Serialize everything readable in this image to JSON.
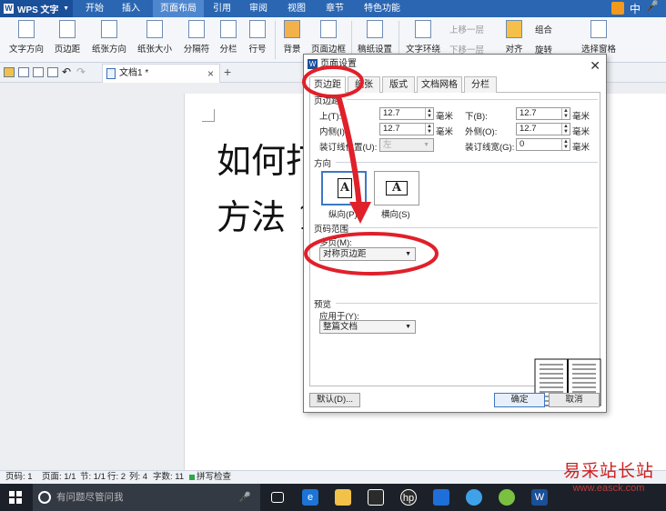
{
  "app": {
    "name": "WPS 文字"
  },
  "menu": {
    "items": [
      "开始",
      "插入",
      "页面布局",
      "引用",
      "审阅",
      "视图",
      "章节",
      "特色功能"
    ],
    "active": "页面布局"
  },
  "tray": {
    "ime": "中",
    "mic": "🎤"
  },
  "ribbon": {
    "buttons": [
      "文字方向",
      "页边距",
      "纸张方向",
      "纸张大小",
      "分隔符",
      "分栏",
      "行号",
      "背景",
      "页面边框",
      "稿纸设置",
      "文字环绕",
      "对齐",
      "旋转",
      "选择窗格"
    ],
    "small": {
      "bring_forward": "上移一层",
      "send_backward": "下移一层",
      "group": "组合"
    }
  },
  "tabs": {
    "doc_name": "文档1 *"
  },
  "document": {
    "line1": "如何打",
    "line2": "方法 1"
  },
  "status": {
    "page_num": "页码: 1",
    "pages": "页面: 1/1",
    "section": "节: 1/1",
    "row": "行: 2",
    "col": "列: 4",
    "words": "字数: 11",
    "spell": "拼写检查"
  },
  "taskbar": {
    "search_placeholder": "有问题尽管问我"
  },
  "watermark": {
    "line1": "易采站长站",
    "line2": "www.easck.com"
  },
  "dialog": {
    "title": "页面设置",
    "tabs": [
      "页边距",
      "纸张",
      "版式",
      "文档网格",
      "分栏"
    ],
    "active_tab": "页边距",
    "section_margin": "页边距",
    "top_label": "上(T):",
    "top_value": "12.7",
    "bottom_label": "下(B):",
    "bottom_value": "12.7",
    "inner_label": "内侧(I):",
    "inner_value": "12.7",
    "outer_label": "外侧(O):",
    "outer_value": "12.7",
    "gutter_pos_label": "装订线位置(U):",
    "gutter_pos_value": "左",
    "gutter_width_label": "装订线宽(G):",
    "gutter_width_value": "0",
    "unit": "毫米",
    "section_orientation": "方向",
    "portrait": "纵向(P)",
    "landscape": "横向(S)",
    "section_pages": "页码范围",
    "multi_pages_label": "多页(M):",
    "multi_pages_value": "对称页边距",
    "section_preview": "预览",
    "apply_to_label": "应用于(Y):",
    "apply_to_value": "整篇文档",
    "default_button": "默认(D)...",
    "ok_button": "确定",
    "cancel_button": "取消"
  },
  "colors": {
    "accent": "#2a66b2",
    "annotation": "#e0202a"
  }
}
